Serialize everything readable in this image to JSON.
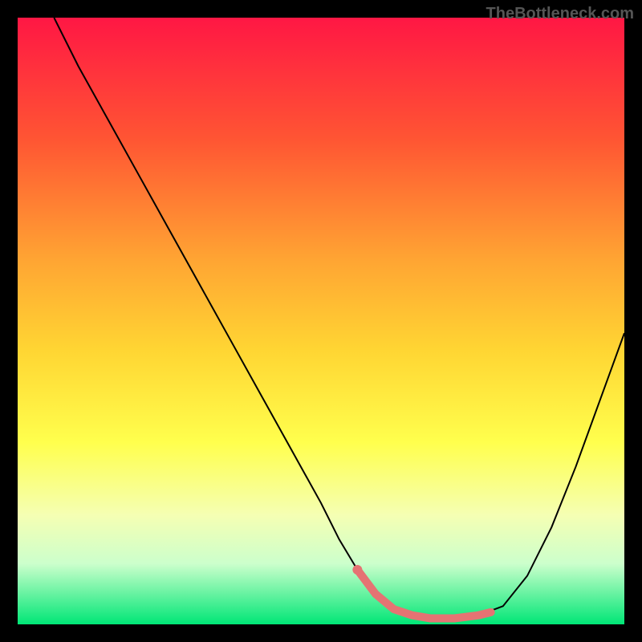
{
  "watermark": "TheBottleneck.com",
  "chart_data": {
    "type": "line",
    "title": "",
    "xlabel": "",
    "ylabel": "",
    "xlim": [
      0,
      100
    ],
    "ylim": [
      0,
      100
    ],
    "background_gradient": {
      "stops": [
        {
          "offset": 0,
          "color": "#ff1744"
        },
        {
          "offset": 20,
          "color": "#ff5533"
        },
        {
          "offset": 40,
          "color": "#ffa533"
        },
        {
          "offset": 55,
          "color": "#ffd633"
        },
        {
          "offset": 70,
          "color": "#ffff4d"
        },
        {
          "offset": 82,
          "color": "#f5ffb3"
        },
        {
          "offset": 90,
          "color": "#ccffcc"
        },
        {
          "offset": 100,
          "color": "#00e676"
        }
      ]
    },
    "series": [
      {
        "name": "bottleneck-curve",
        "color": "#000000",
        "width": 2,
        "x": [
          6,
          10,
          15,
          20,
          25,
          30,
          35,
          40,
          45,
          50,
          53,
          56,
          59,
          62,
          65,
          68,
          72,
          76,
          80,
          84,
          88,
          92,
          96,
          100
        ],
        "y": [
          100,
          92,
          83,
          74,
          65,
          56,
          47,
          38,
          29,
          20,
          14,
          9,
          5,
          2.5,
          1.5,
          1,
          1,
          1.5,
          3,
          8,
          16,
          26,
          37,
          48
        ]
      },
      {
        "name": "optimal-range",
        "color": "#e57373",
        "width": 10,
        "linecap": "round",
        "x": [
          56,
          59,
          62,
          65,
          68,
          72,
          76,
          78
        ],
        "y": [
          9,
          5,
          2.5,
          1.5,
          1,
          1,
          1.5,
          2
        ]
      }
    ],
    "markers": [
      {
        "name": "optimal-point",
        "x": 56,
        "y": 9,
        "color": "#e57373",
        "radius": 6
      }
    ]
  }
}
